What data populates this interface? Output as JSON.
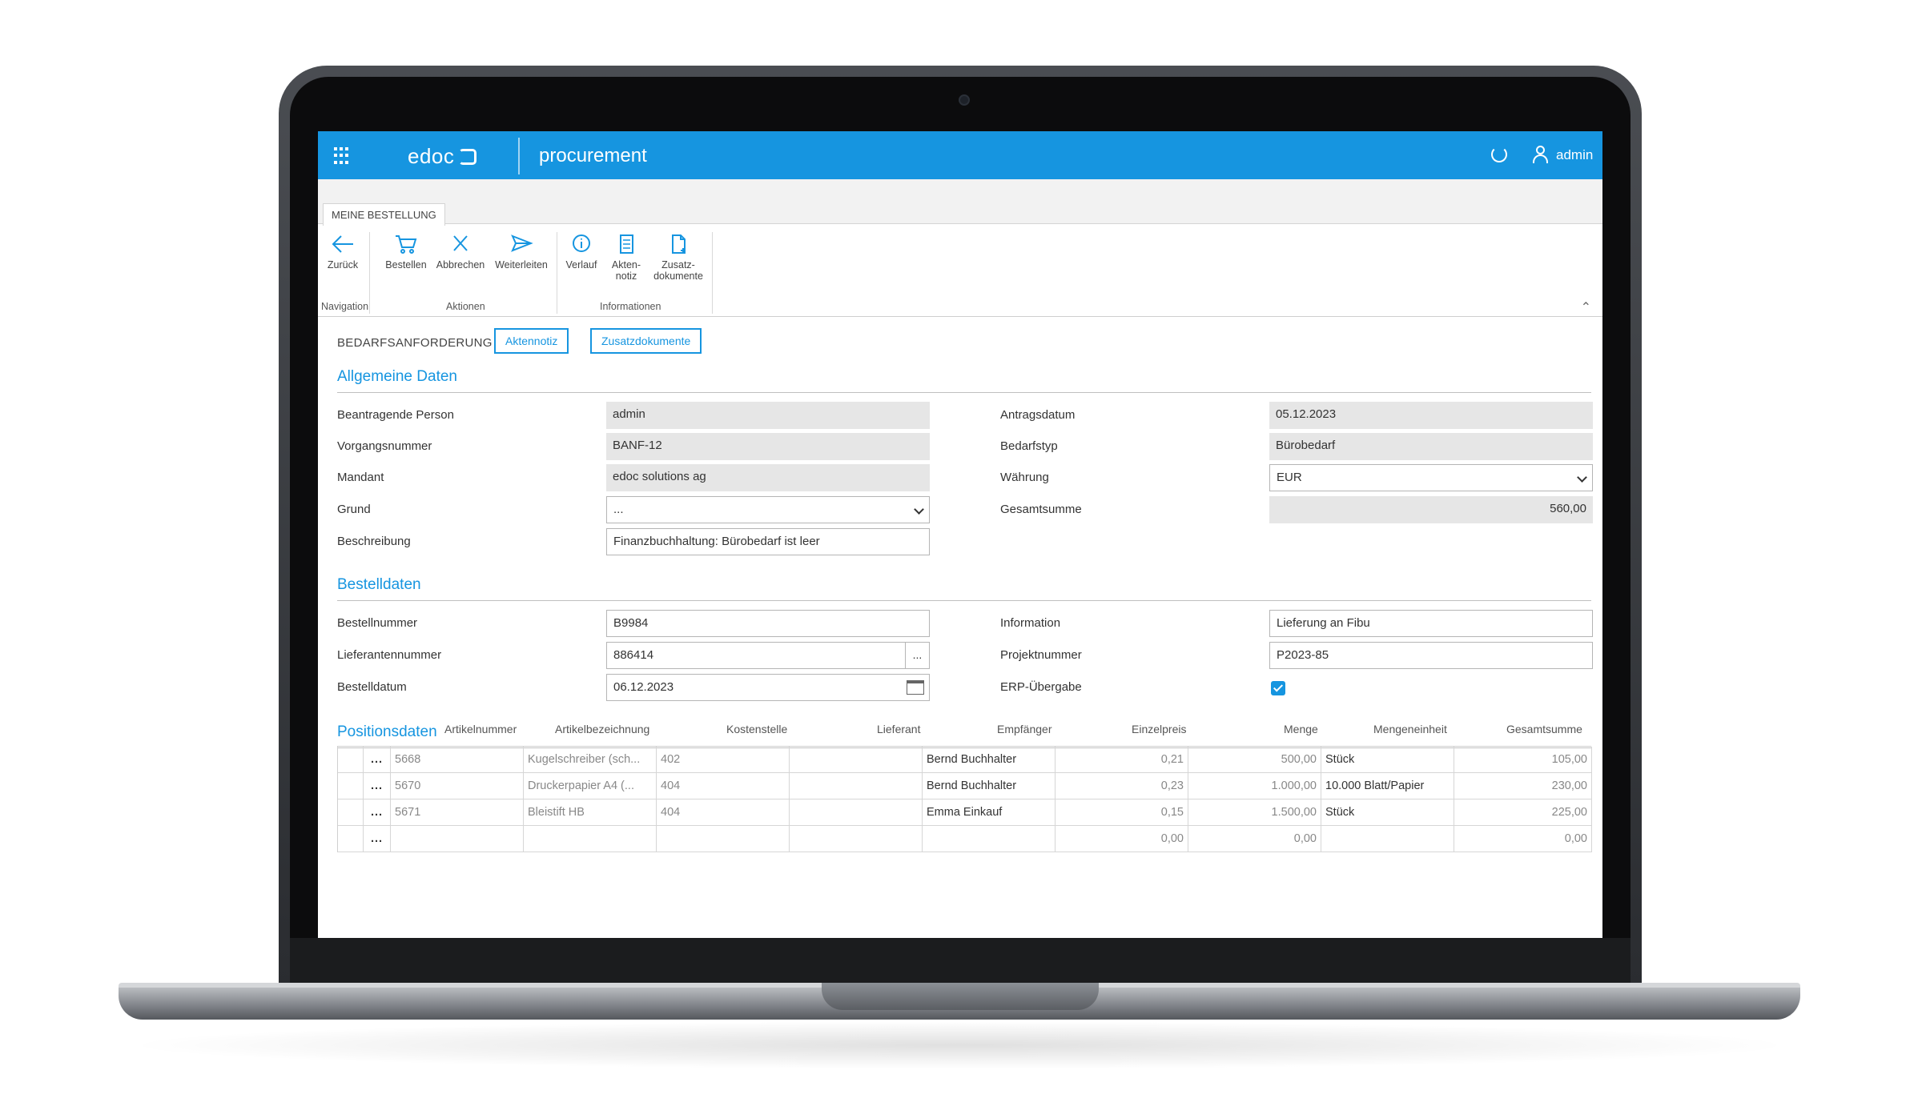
{
  "app": {
    "brand": "edoc",
    "name": "procurement",
    "user": "admin"
  },
  "ribbon": {
    "tab": "MEINE BESTELLUNG",
    "buttons": {
      "back": "Zurück",
      "order": "Bestellen",
      "cancel": "Abbrechen",
      "forward": "Weiterleiten",
      "history": "Verlauf",
      "note_line1": "Akten-",
      "note_line2": "notiz",
      "docs_line1": "Zusatz-",
      "docs_line2": "dokumente"
    },
    "groups": {
      "navigation": "Navigation",
      "actions": "Aktionen",
      "info": "Informationen"
    }
  },
  "doc": {
    "type": "BEDARFSANFORDERUNG",
    "note_link": "Aktennotiz",
    "docs_link": "Zusatzdokumente"
  },
  "general": {
    "title": "Allgemeine Daten",
    "requester_label": "Beantragende Person",
    "requester": "admin",
    "process_label": "Vorgangsnummer",
    "process": "BANF-12",
    "client_label": "Mandant",
    "client": "edoc solutions ag",
    "reason_label": "Grund",
    "reason": "...",
    "description_label": "Beschreibung",
    "description": "Finanzbuchhaltung: Bürobedarf ist leer",
    "date_label": "Antragsdatum",
    "date": "05.12.2023",
    "need_type_label": "Bedarfstyp",
    "need_type": "Bürobedarf",
    "currency_label": "Währung",
    "currency": "EUR",
    "total_label": "Gesamtsumme",
    "total": "560,00"
  },
  "order": {
    "title": "Bestelldaten",
    "number_label": "Bestellnummer",
    "number": "B9984",
    "supplier_label": "Lieferantennummer",
    "supplier": "886414",
    "supplier_btn": "...",
    "date_label": "Bestelldatum",
    "date": "06.12.2023",
    "info_label": "Information",
    "info": "Lieferung an Fibu",
    "project_label": "Projektnummer",
    "project": "P2023-85",
    "erp_label": "ERP-Übergabe",
    "erp_checked": true
  },
  "positions": {
    "title": "Positionsdaten",
    "headers": {
      "article_no": "Artikelnummer",
      "article_name": "Artikelbezeichnung",
      "cost_center": "Kostenstelle",
      "supplier": "Lieferant",
      "recipient": "Empfänger",
      "unit_price": "Einzelpreis",
      "quantity": "Menge",
      "unit": "Mengeneinheit",
      "total": "Gesamtsumme"
    },
    "rows": [
      {
        "menu": "...",
        "article_no": "5668",
        "article_name": "Kugelschreiber (sch...",
        "cost_center": "402",
        "supplier": "",
        "recipient": "Bernd Buchhalter",
        "unit_price": "0,21",
        "quantity": "500,00",
        "unit": "Stück",
        "total": "105,00"
      },
      {
        "menu": "...",
        "article_no": "5670",
        "article_name": "Druckerpapier A4 (...",
        "cost_center": "404",
        "supplier": "",
        "recipient": "Bernd Buchhalter",
        "unit_price": "0,23",
        "quantity": "1.000,00",
        "unit": "10.000 Blatt/Papier",
        "total": "230,00"
      },
      {
        "menu": "...",
        "article_no": "5671",
        "article_name": "Bleistift HB",
        "cost_center": "404",
        "supplier": "",
        "recipient": "Emma Einkauf",
        "unit_price": "0,15",
        "quantity": "1.500,00",
        "unit": "Stück",
        "total": "225,00"
      },
      {
        "menu": "...",
        "article_no": "",
        "article_name": "",
        "cost_center": "",
        "supplier": "",
        "recipient": "",
        "unit_price": "0,00",
        "quantity": "0,00",
        "unit": "",
        "total": "0,00"
      }
    ]
  },
  "colors": {
    "accent": "#1695e0",
    "readonly_field": "#e6e6e6"
  }
}
